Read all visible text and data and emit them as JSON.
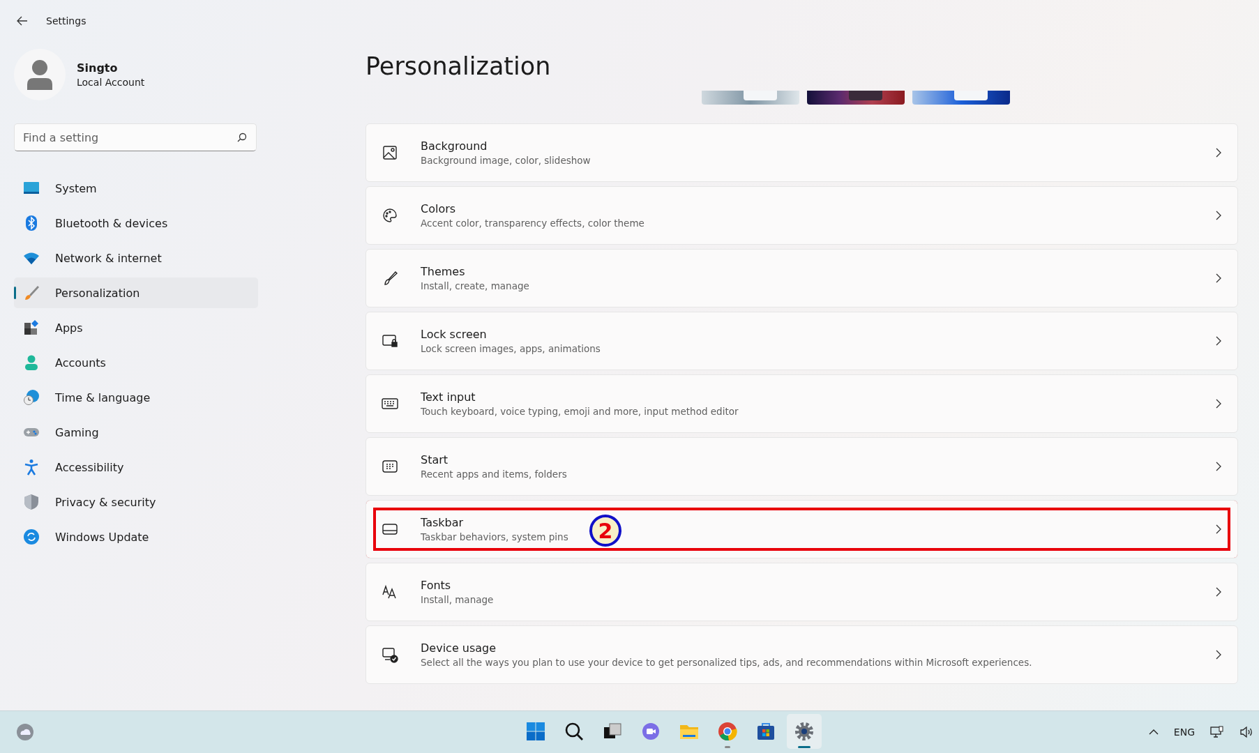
{
  "window": {
    "title": "Settings"
  },
  "account": {
    "name": "Singto",
    "type": "Local Account"
  },
  "search": {
    "placeholder": "Find a setting"
  },
  "sidebar": {
    "items": [
      {
        "label": "System",
        "kind": "system",
        "selected": false
      },
      {
        "label": "Bluetooth & devices",
        "kind": "bluetooth",
        "selected": false
      },
      {
        "label": "Network & internet",
        "kind": "network",
        "selected": false
      },
      {
        "label": "Personalization",
        "kind": "brush",
        "selected": true
      },
      {
        "label": "Apps",
        "kind": "apps",
        "selected": false
      },
      {
        "label": "Accounts",
        "kind": "accounts",
        "selected": false
      },
      {
        "label": "Time & language",
        "kind": "time",
        "selected": false
      },
      {
        "label": "Gaming",
        "kind": "gaming",
        "selected": false
      },
      {
        "label": "Accessibility",
        "kind": "accessibility",
        "selected": false
      },
      {
        "label": "Privacy & security",
        "kind": "privacy",
        "selected": false
      },
      {
        "label": "Windows Update",
        "kind": "update",
        "selected": false
      }
    ]
  },
  "page": {
    "title": "Personalization"
  },
  "settings": [
    {
      "title": "Background",
      "description": "Background image, color, slideshow",
      "kind": "image",
      "highlighted": false
    },
    {
      "title": "Colors",
      "description": "Accent color, transparency effects, color theme",
      "kind": "palette",
      "highlighted": false
    },
    {
      "title": "Themes",
      "description": "Install, create, manage",
      "kind": "brush",
      "highlighted": false
    },
    {
      "title": "Lock screen",
      "description": "Lock screen images, apps, animations",
      "kind": "lock",
      "highlighted": false
    },
    {
      "title": "Text input",
      "description": "Touch keyboard, voice typing, emoji and more, input method editor",
      "kind": "keyboard",
      "highlighted": false
    },
    {
      "title": "Start",
      "description": "Recent apps and items, folders",
      "kind": "start",
      "highlighted": false
    },
    {
      "title": "Taskbar",
      "description": "Taskbar behaviors, system pins",
      "kind": "taskbar",
      "highlighted": true
    },
    {
      "title": "Fonts",
      "description": "Install, manage",
      "kind": "fonts",
      "highlighted": false
    },
    {
      "title": "Device usage",
      "description": "Select all the ways you plan to use your device to get personalized tips, ads, and recommendations within Microsoft experiences.",
      "kind": "device",
      "highlighted": false
    }
  ],
  "annotation": {
    "label": "2"
  },
  "taskbar": {
    "apps": [
      {
        "kind": "start",
        "running": false,
        "selected": false
      },
      {
        "kind": "search",
        "running": false,
        "selected": false
      },
      {
        "kind": "taskview",
        "running": false,
        "selected": false
      },
      {
        "kind": "chat",
        "running": false,
        "selected": false
      },
      {
        "kind": "explorer",
        "running": false,
        "selected": false
      },
      {
        "kind": "chrome",
        "running": true,
        "selected": false
      },
      {
        "kind": "store",
        "running": false,
        "selected": false
      },
      {
        "kind": "settings",
        "running": true,
        "selected": true
      }
    ],
    "language": "ENG"
  }
}
